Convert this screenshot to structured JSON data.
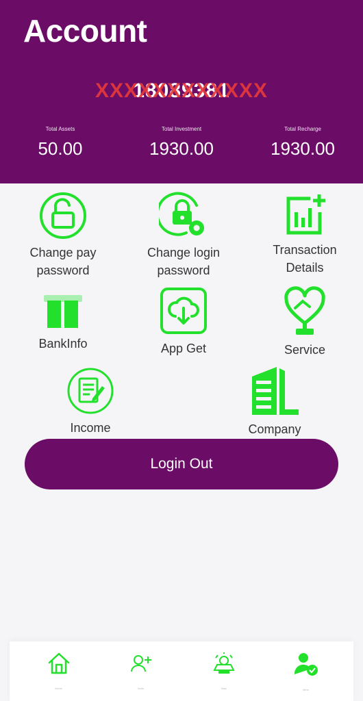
{
  "header": {
    "title": "Account",
    "account_id": "18089381",
    "account_mask": "XXXXXXXXXXXX",
    "stats": [
      {
        "label": "Total Assets",
        "value": "50.00"
      },
      {
        "label": "Total Investment",
        "value": "1930.00"
      },
      {
        "label": "Total Recharge",
        "value": "1930.00"
      }
    ]
  },
  "menu": {
    "change_pay_password": [
      "Change pay",
      "password"
    ],
    "change_login_password": [
      "Change login",
      "password"
    ],
    "transaction_details": [
      "Transaction",
      "Details"
    ],
    "bank_info": "BankInfo",
    "app_get": "App Get",
    "service": "Service",
    "income": "Income",
    "company": "Company"
  },
  "logout_label": "Login Out",
  "tabbar": {
    "items": [
      {
        "label": "Home",
        "icon": "home-icon"
      },
      {
        "label": "Invite",
        "icon": "add-user-icon"
      },
      {
        "label": "Task",
        "icon": "vip-icon"
      },
      {
        "label": "Mine",
        "icon": "user-check-icon"
      }
    ]
  },
  "colors": {
    "brand": "#6b0c67",
    "accent": "#22e02c",
    "mask": "#e5393a"
  }
}
